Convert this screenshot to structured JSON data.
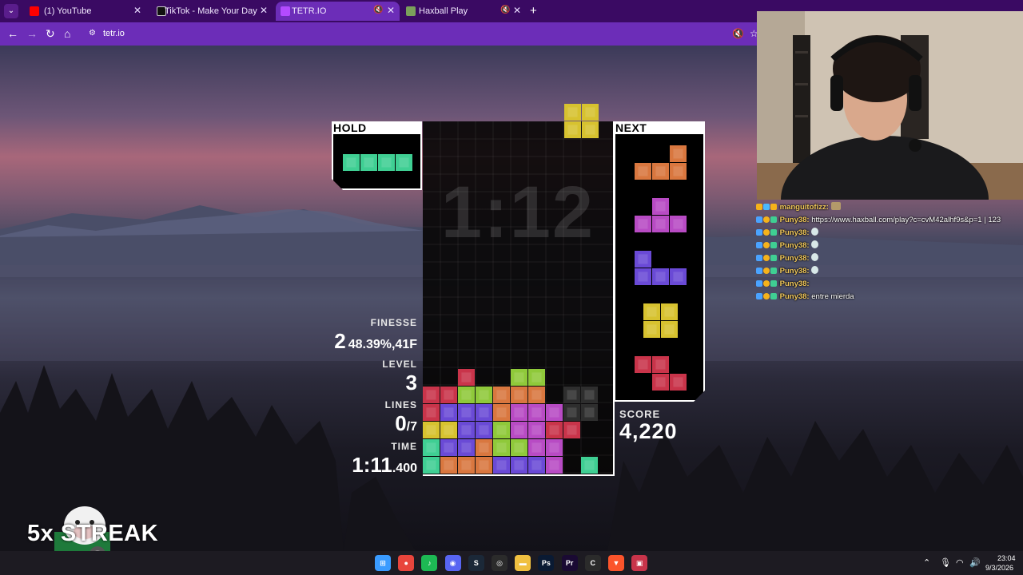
{
  "browser": {
    "tabs": [
      {
        "title": "(1) YouTube",
        "active": false,
        "favicon_color": "#ff0000"
      },
      {
        "title": "TikTok - Make Your Day",
        "active": false,
        "favicon_color": "#111111"
      },
      {
        "title": "TETR.IO",
        "active": true,
        "favicon_color": "#b34bff"
      },
      {
        "title": "Haxball Play",
        "active": false,
        "favicon_color": "#7ba05b"
      }
    ],
    "url": "tetr.io"
  },
  "game": {
    "hold_label": "HOLD",
    "next_label": "NEXT",
    "big_timer": "1:12",
    "finesse_label": "FINESSE",
    "finesse_count": "2",
    "finesse_detail": "48.39%,41F",
    "level_label": "LEVEL",
    "level_value": "3",
    "lines_label": "LINES",
    "lines_value": "0",
    "lines_target": "/7",
    "time_label": "TIME",
    "time_main": "1:11",
    "time_ms": ".400",
    "score_label": "SCORE",
    "score_value": "4,220",
    "streak_text": "5x STREAK",
    "hold_piece": "I",
    "next_queue": [
      "L",
      "T",
      "J",
      "O",
      "Z"
    ],
    "colors": {
      "I": "#3fcf93",
      "O": "#d7c22f",
      "T": "#b84bc4",
      "L": "#d9773f",
      "J": "#6a4ad6",
      "S": "#8fc93a",
      "Z": "#c9344a",
      "G": "#2e2e2e"
    },
    "board_bottom_rows": [
      "..Z..SS...",
      "ZZSSLLL.GG",
      "ZJJJLTTTGG",
      "OOJJSTTZZ.",
      "IJJLSSTT..",
      "ILLLJJJT.I"
    ],
    "falling_piece": "O"
  },
  "chat": [
    {
      "user": "manguitofizz:",
      "message": "",
      "badges": [
        "#f5b21a",
        "#4ab8ff",
        "#f5b21a"
      ]
    },
    {
      "user": "Puny38:",
      "message": "https://www.haxball.com/play?c=cvM42alhf9s&p=1 | 123",
      "badges": [
        "#4aa3ff",
        "#f5b21a",
        "#3fcf93"
      ]
    },
    {
      "user": "Puny38:",
      "message": "",
      "badges": [
        "#4aa3ff",
        "#f5b21a",
        "#3fcf93"
      ]
    },
    {
      "user": "Puny38:",
      "message": "",
      "badges": [
        "#4aa3ff",
        "#f5b21a",
        "#3fcf93"
      ]
    },
    {
      "user": "Puny38:",
      "message": "",
      "badges": [
        "#4aa3ff",
        "#f5b21a",
        "#3fcf93"
      ]
    },
    {
      "user": "Puny38:",
      "message": "",
      "badges": [
        "#4aa3ff",
        "#f5b21a",
        "#3fcf93"
      ]
    },
    {
      "user": "Puny38:",
      "message": "",
      "badges": [
        "#4aa3ff",
        "#f5b21a",
        "#3fcf93"
      ]
    },
    {
      "user": "Puny38:",
      "message": "entre mierda",
      "badges": [
        "#4aa3ff",
        "#f5b21a",
        "#3fcf93"
      ]
    }
  ],
  "taskbar": {
    "apps": [
      {
        "name": "windows-start-icon",
        "glyph": "⊞",
        "color": "#3a9bff"
      },
      {
        "name": "chrome-icon",
        "glyph": "●",
        "color": "#e8453c"
      },
      {
        "name": "spotify-icon",
        "glyph": "♪",
        "color": "#1db954"
      },
      {
        "name": "discord-icon",
        "glyph": "◉",
        "color": "#5865f2"
      },
      {
        "name": "steam-icon",
        "glyph": "S",
        "color": "#1b2838"
      },
      {
        "name": "obs-icon",
        "glyph": "◎",
        "color": "#2b2b2b"
      },
      {
        "name": "file-explorer-icon",
        "glyph": "▬",
        "color": "#f0c040"
      },
      {
        "name": "photoshop-icon",
        "glyph": "Ps",
        "color": "#0a1a33"
      },
      {
        "name": "premiere-icon",
        "glyph": "Pr",
        "color": "#1a0a33"
      },
      {
        "name": "ccleaner-icon",
        "glyph": "C",
        "color": "#2b2b2b"
      },
      {
        "name": "brave-icon",
        "glyph": "▼",
        "color": "#fb542b"
      },
      {
        "name": "app-icon",
        "glyph": "▣",
        "color": "#c8344a"
      }
    ],
    "time": "23:04",
    "date": "9/3/2026"
  }
}
